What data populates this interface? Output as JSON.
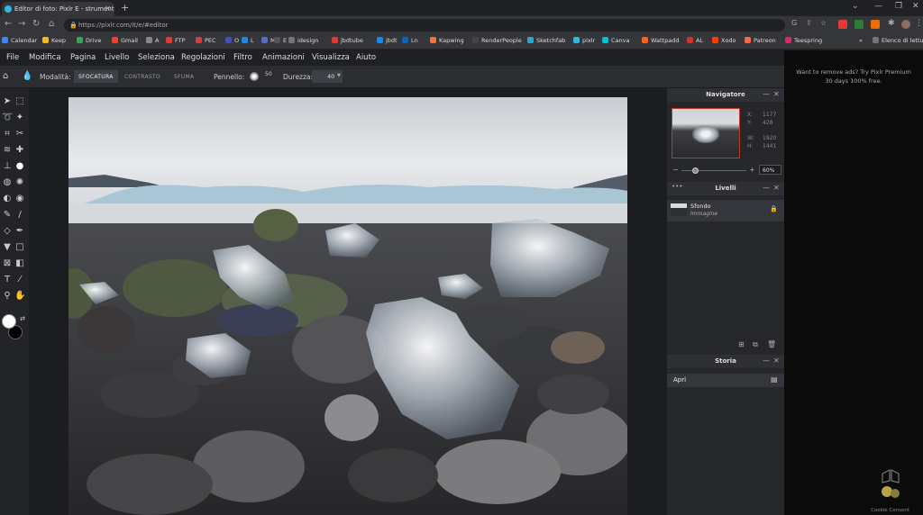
{
  "browser": {
    "tab_title": "Editor di foto: Pixlr E - strumenti...",
    "new_tab": "+",
    "url": "https://pixlr.com/it/e/#editor",
    "window_controls": [
      "⌄",
      "—",
      "❐",
      "✕"
    ],
    "bookmarks": [
      {
        "label": "Calendar",
        "color": "#4285f4"
      },
      {
        "label": "Keep",
        "color": "#fbbc04"
      },
      {
        "label": "Drive",
        "color": "#34a853"
      },
      {
        "label": "Gmail",
        "color": "#ea4335"
      },
      {
        "label": "A",
        "color": "#888888"
      },
      {
        "label": "FTP",
        "color": "#e53935"
      },
      {
        "label": "PEC",
        "color": "#e53935"
      },
      {
        "label": "O",
        "color": "#3f51b5"
      },
      {
        "label": "L",
        "color": "#1e88e5"
      },
      {
        "label": "M",
        "color": "#5c6bc0"
      },
      {
        "label": "E",
        "color": "#555555"
      },
      {
        "label": "idesign",
        "color": "#777777"
      },
      {
        "label": "jbdtube",
        "color": "#e53935"
      },
      {
        "label": "jbdt",
        "color": "#1e88e5"
      },
      {
        "label": "Ln",
        "color": "#0a66c2"
      },
      {
        "label": "Kapwing",
        "color": "#ff6d3a"
      },
      {
        "label": "RenderPeople",
        "color": "#444444"
      },
      {
        "label": "Sketchfab",
        "color": "#1caad9"
      },
      {
        "label": "pixlr",
        "color": "#33b5e5"
      },
      {
        "label": "Canva",
        "color": "#00c4cc"
      },
      {
        "label": "Wattpadd",
        "color": "#ff6122"
      },
      {
        "label": "AL",
        "color": "#d32f2f"
      },
      {
        "label": "Xodo",
        "color": "#ff3d00"
      },
      {
        "label": "Patreon",
        "color": "#f96854"
      },
      {
        "label": "Teespring",
        "color": "#e91e63"
      }
    ],
    "reading_list": "Elenco di lettura"
  },
  "menu": [
    "File",
    "Modifica",
    "Pagina",
    "Livello",
    "Seleziona",
    "Regolazioni",
    "Filtro",
    "Animazioni",
    "Visualizza",
    "Aiuto"
  ],
  "options": {
    "mode_label": "Modalità:",
    "modes": [
      {
        "label": "SFOCATURA",
        "active": true
      },
      {
        "label": "CONTRASTO",
        "active": false
      },
      {
        "label": "SFUMA",
        "active": false
      }
    ],
    "brush_label": "Pennello:",
    "brush_size": "50",
    "hardness_label": "Durezza:",
    "hardness_value": "40"
  },
  "navigator": {
    "title": "Navigatore",
    "x_label": "X:",
    "x_value": "1177",
    "y_label": "Y:",
    "y_value": "428",
    "w_label": "W:",
    "w_value": "1920",
    "h_label": "H:",
    "h_value": "1441",
    "zoom": "60%",
    "zoom_fraction": 0.22
  },
  "layers": {
    "title": "Livelli",
    "items": [
      {
        "name": "Sfondo",
        "type": "Immagine"
      }
    ]
  },
  "history": {
    "title": "Storia",
    "items": [
      "Apri"
    ]
  },
  "ad": {
    "line1": "Want to remove ads? Try Pixlr Premium",
    "line2": "30 days 100% free."
  },
  "watermark": "Cookie Consent",
  "colors": {
    "primary": "#ffffff",
    "secondary": "#000000"
  }
}
